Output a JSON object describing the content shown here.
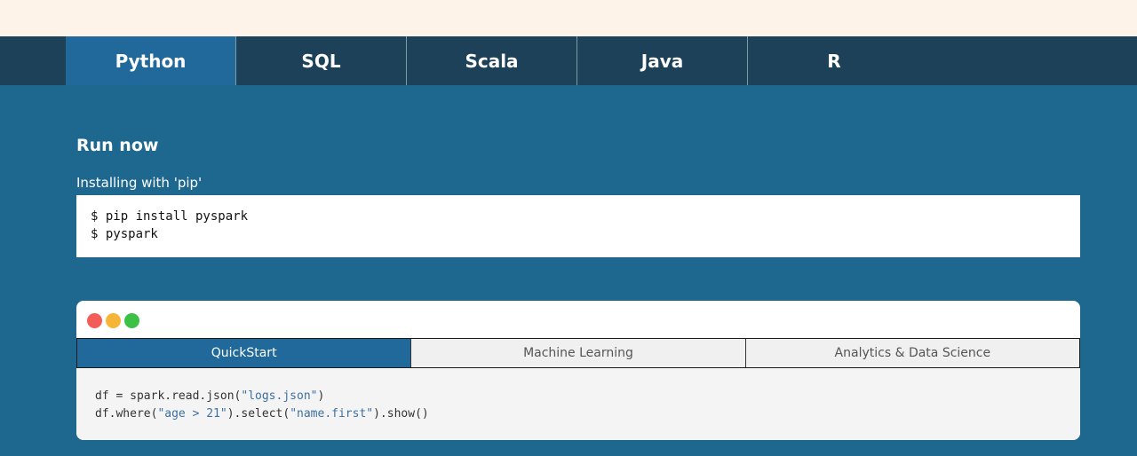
{
  "language_tabs": [
    {
      "label": "Python",
      "active": true
    },
    {
      "label": "SQL",
      "active": false
    },
    {
      "label": "Scala",
      "active": false
    },
    {
      "label": "Java",
      "active": false
    },
    {
      "label": "R",
      "active": false
    }
  ],
  "run_now": {
    "title": "Run now",
    "install_label": "Installing with 'pip'",
    "commands": [
      "$ pip install pyspark",
      "$ pyspark"
    ]
  },
  "example_window": {
    "tabs": [
      {
        "label": "QuickStart",
        "active": true
      },
      {
        "label": "Machine Learning",
        "active": false
      },
      {
        "label": "Analytics & Data Science",
        "active": false
      }
    ],
    "code": {
      "line1_prefix": "df = spark.read.json(",
      "line1_string": "\"logs.json\"",
      "line1_suffix": ")",
      "line2_prefix": "df.where(",
      "line2_string1": "\"age > 21\"",
      "line2_middle": ").select(",
      "line2_string2": "\"name.first\"",
      "line2_suffix": ").show()"
    }
  },
  "colors": {
    "page_bg": "#1e6890",
    "top_band": "#fef3e9",
    "nav_bg": "#1c4159",
    "active_tab": "#20699a",
    "dot_red": "#f25e57",
    "dot_yellow": "#f7b538",
    "dot_green": "#3cc046"
  }
}
